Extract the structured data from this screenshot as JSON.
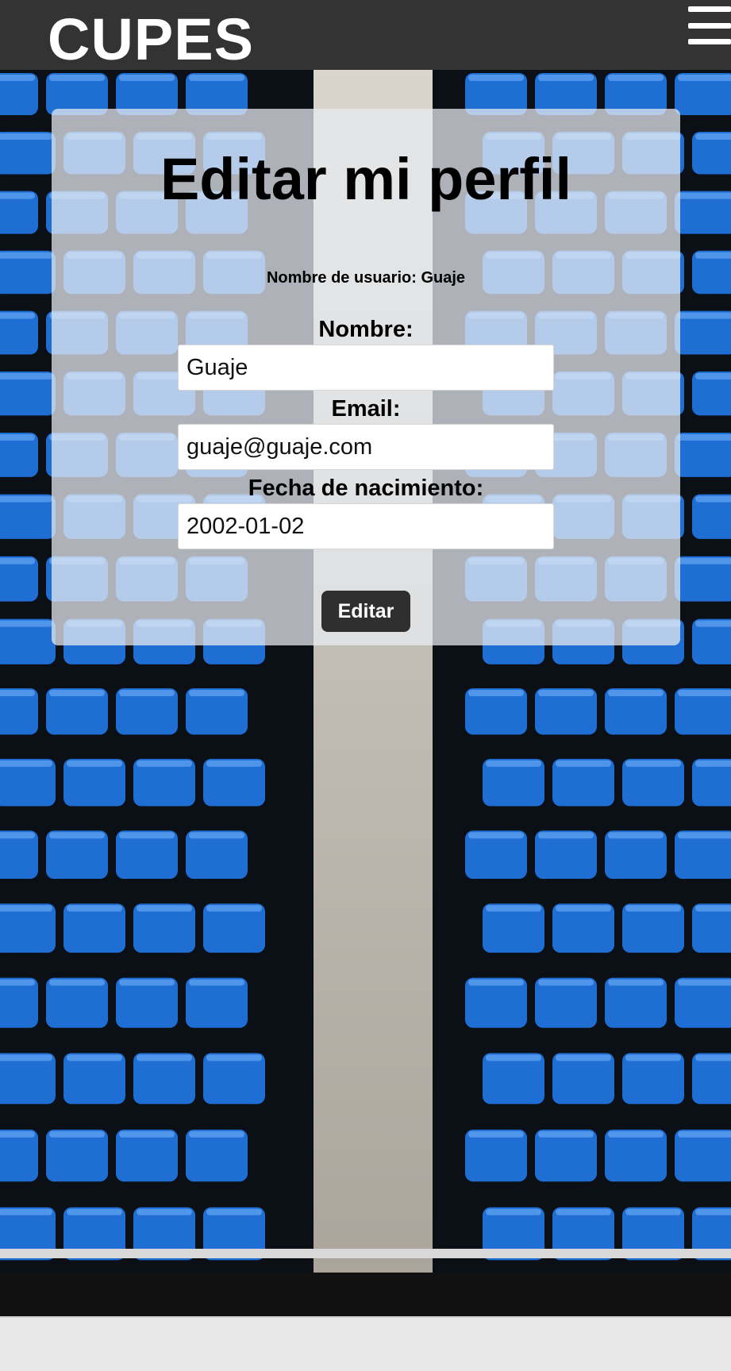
{
  "header": {
    "brand": "CUPES"
  },
  "icons": {
    "menu": "hamburger-menu-icon"
  },
  "colors": {
    "header_bg": "#333333",
    "seat_blue": "#1f6ed4",
    "button_bg": "#2f2f2f"
  },
  "card": {
    "title": "Editar mi perfil",
    "username_line": "Nombre de usuario: Guaje"
  },
  "form": {
    "nombre_label": "Nombre:",
    "nombre_value": "Guaje",
    "email_label": "Email:",
    "email_value": "guaje@guaje.com",
    "fecha_label": "Fecha de nacimiento:",
    "fecha_value": "2002-01-02",
    "submit_label": "Editar"
  }
}
